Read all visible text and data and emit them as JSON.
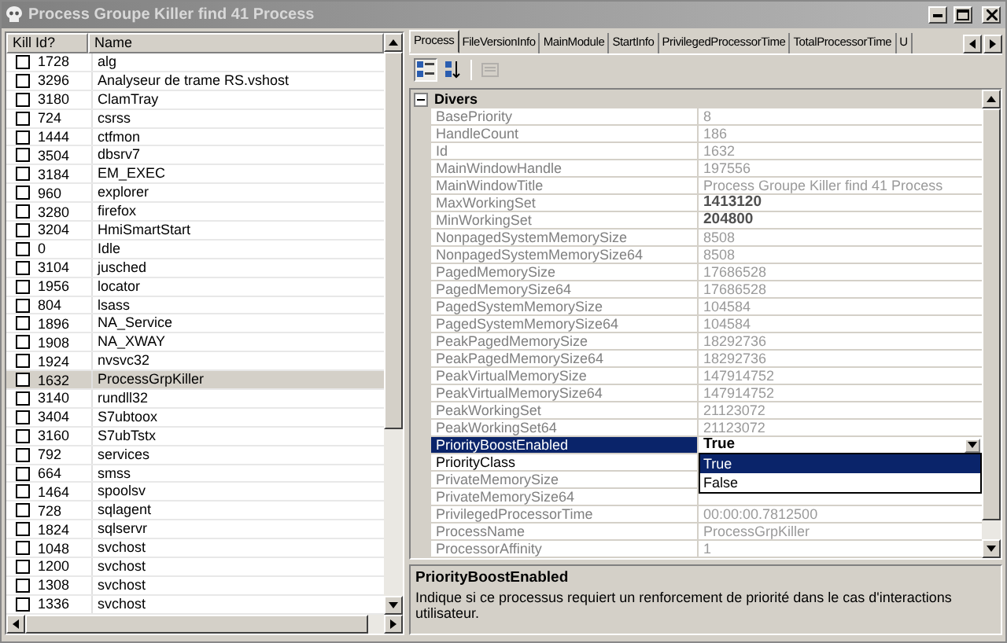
{
  "window": {
    "title": "Process Groupe Killer find 41 Process"
  },
  "process_list": {
    "columns": [
      "Kill Id?",
      "Name"
    ],
    "rows": [
      {
        "checked": false,
        "id": "1728",
        "name": "alg",
        "selected": false
      },
      {
        "checked": false,
        "id": "3296",
        "name": "Analyseur de trame RS.vshost",
        "selected": false
      },
      {
        "checked": false,
        "id": "3180",
        "name": "ClamTray",
        "selected": false
      },
      {
        "checked": false,
        "id": "724",
        "name": "csrss",
        "selected": false
      },
      {
        "checked": false,
        "id": "1444",
        "name": "ctfmon",
        "selected": false
      },
      {
        "checked": false,
        "id": "3504",
        "name": "dbsrv7",
        "selected": false
      },
      {
        "checked": false,
        "id": "3184",
        "name": "EM_EXEC",
        "selected": false
      },
      {
        "checked": false,
        "id": "960",
        "name": "explorer",
        "selected": false
      },
      {
        "checked": false,
        "id": "3280",
        "name": "firefox",
        "selected": false
      },
      {
        "checked": false,
        "id": "3204",
        "name": "HmiSmartStart",
        "selected": false
      },
      {
        "checked": false,
        "id": "0",
        "name": "Idle",
        "selected": false
      },
      {
        "checked": false,
        "id": "3104",
        "name": "jusched",
        "selected": false
      },
      {
        "checked": false,
        "id": "1956",
        "name": "locator",
        "selected": false
      },
      {
        "checked": false,
        "id": "804",
        "name": "lsass",
        "selected": false
      },
      {
        "checked": false,
        "id": "1896",
        "name": "NA_Service",
        "selected": false
      },
      {
        "checked": false,
        "id": "1908",
        "name": "NA_XWAY",
        "selected": false
      },
      {
        "checked": false,
        "id": "1924",
        "name": "nvsvc32",
        "selected": false
      },
      {
        "checked": false,
        "id": "1632",
        "name": "ProcessGrpKiller",
        "selected": true
      },
      {
        "checked": false,
        "id": "3140",
        "name": "rundll32",
        "selected": false
      },
      {
        "checked": false,
        "id": "3404",
        "name": "S7ubtoox",
        "selected": false
      },
      {
        "checked": false,
        "id": "3160",
        "name": "S7ubTstx",
        "selected": false
      },
      {
        "checked": false,
        "id": "792",
        "name": "services",
        "selected": false
      },
      {
        "checked": false,
        "id": "664",
        "name": "smss",
        "selected": false
      },
      {
        "checked": false,
        "id": "1464",
        "name": "spoolsv",
        "selected": false
      },
      {
        "checked": false,
        "id": "728",
        "name": "sqlagent",
        "selected": false
      },
      {
        "checked": false,
        "id": "1824",
        "name": "sqlservr",
        "selected": false
      },
      {
        "checked": false,
        "id": "1048",
        "name": "svchost",
        "selected": false
      },
      {
        "checked": false,
        "id": "1200",
        "name": "svchost",
        "selected": false
      },
      {
        "checked": false,
        "id": "1308",
        "name": "svchost",
        "selected": false
      },
      {
        "checked": false,
        "id": "1336",
        "name": "svchost",
        "selected": false
      }
    ]
  },
  "tabs": [
    {
      "label": "Process",
      "selected": true
    },
    {
      "label": "FileVersionInfo",
      "selected": false
    },
    {
      "label": "MainModule",
      "selected": false
    },
    {
      "label": "StartInfo",
      "selected": false
    },
    {
      "label": "PrivilegedProcessorTime",
      "selected": false
    },
    {
      "label": "TotalProcessorTime",
      "selected": false
    },
    {
      "label": "U",
      "selected": false
    }
  ],
  "toolbar": [
    {
      "kind": "categorized",
      "selected": true,
      "disabled": false
    },
    {
      "kind": "alphabetical",
      "selected": false,
      "disabled": false
    },
    {
      "kind": "property-pages",
      "selected": false,
      "disabled": true
    }
  ],
  "property_grid": {
    "category": {
      "label": "Divers",
      "expanded": true
    },
    "properties": [
      {
        "name": "BasePriority",
        "value": "8",
        "read_only": true,
        "modified": false,
        "selected": false
      },
      {
        "name": "HandleCount",
        "value": "186",
        "read_only": true,
        "modified": false,
        "selected": false
      },
      {
        "name": "Id",
        "value": "1632",
        "read_only": true,
        "modified": false,
        "selected": false
      },
      {
        "name": "MainWindowHandle",
        "value": "197556",
        "read_only": true,
        "modified": false,
        "selected": false
      },
      {
        "name": "MainWindowTitle",
        "value": "Process Groupe Killer find 41 Process",
        "read_only": true,
        "modified": false,
        "selected": false
      },
      {
        "name": "MaxWorkingSet",
        "value": "1413120",
        "read_only": true,
        "modified": true,
        "selected": false
      },
      {
        "name": "MinWorkingSet",
        "value": "204800",
        "read_only": true,
        "modified": true,
        "selected": false
      },
      {
        "name": "NonpagedSystemMemorySize",
        "value": "8508",
        "read_only": true,
        "modified": false,
        "selected": false
      },
      {
        "name": "NonpagedSystemMemorySize64",
        "value": "8508",
        "read_only": true,
        "modified": false,
        "selected": false
      },
      {
        "name": "PagedMemorySize",
        "value": "17686528",
        "read_only": true,
        "modified": false,
        "selected": false
      },
      {
        "name": "PagedMemorySize64",
        "value": "17686528",
        "read_only": true,
        "modified": false,
        "selected": false
      },
      {
        "name": "PagedSystemMemorySize",
        "value": "104584",
        "read_only": true,
        "modified": false,
        "selected": false
      },
      {
        "name": "PagedSystemMemorySize64",
        "value": "104584",
        "read_only": true,
        "modified": false,
        "selected": false
      },
      {
        "name": "PeakPagedMemorySize",
        "value": "18292736",
        "read_only": true,
        "modified": false,
        "selected": false
      },
      {
        "name": "PeakPagedMemorySize64",
        "value": "18292736",
        "read_only": true,
        "modified": false,
        "selected": false
      },
      {
        "name": "PeakVirtualMemorySize",
        "value": "147914752",
        "read_only": true,
        "modified": false,
        "selected": false
      },
      {
        "name": "PeakVirtualMemorySize64",
        "value": "147914752",
        "read_only": true,
        "modified": false,
        "selected": false
      },
      {
        "name": "PeakWorkingSet",
        "value": "21123072",
        "read_only": true,
        "modified": false,
        "selected": false
      },
      {
        "name": "PeakWorkingSet64",
        "value": "21123072",
        "read_only": true,
        "modified": false,
        "selected": false
      },
      {
        "name": "PriorityBoostEnabled",
        "value": "True",
        "read_only": false,
        "modified": true,
        "selected": true
      },
      {
        "name": "PriorityClass",
        "read_only": false,
        "selected": false
      },
      {
        "name": "PrivateMemorySize",
        "read_only": true,
        "selected": false
      },
      {
        "name": "PrivateMemorySize64",
        "read_only": true,
        "selected": false
      },
      {
        "name": "PrivilegedProcessorTime",
        "value": "00:00:00.7812500",
        "read_only": true,
        "modified": false,
        "selected": false
      },
      {
        "name": "ProcessName",
        "value": "ProcessGrpKiller",
        "read_only": true,
        "modified": false,
        "selected": false
      },
      {
        "name": "ProcessorAffinity",
        "value": "1",
        "read_only": true,
        "modified": false,
        "selected": false
      }
    ],
    "dropdown": {
      "options": [
        {
          "label": "True",
          "selected": true
        },
        {
          "label": "False",
          "selected": false
        }
      ]
    }
  },
  "description": {
    "title": "PriorityBoostEnabled",
    "text": "Indique si ce processus requiert un renforcement de priorité dans le cas d'interactions utilisateur."
  }
}
